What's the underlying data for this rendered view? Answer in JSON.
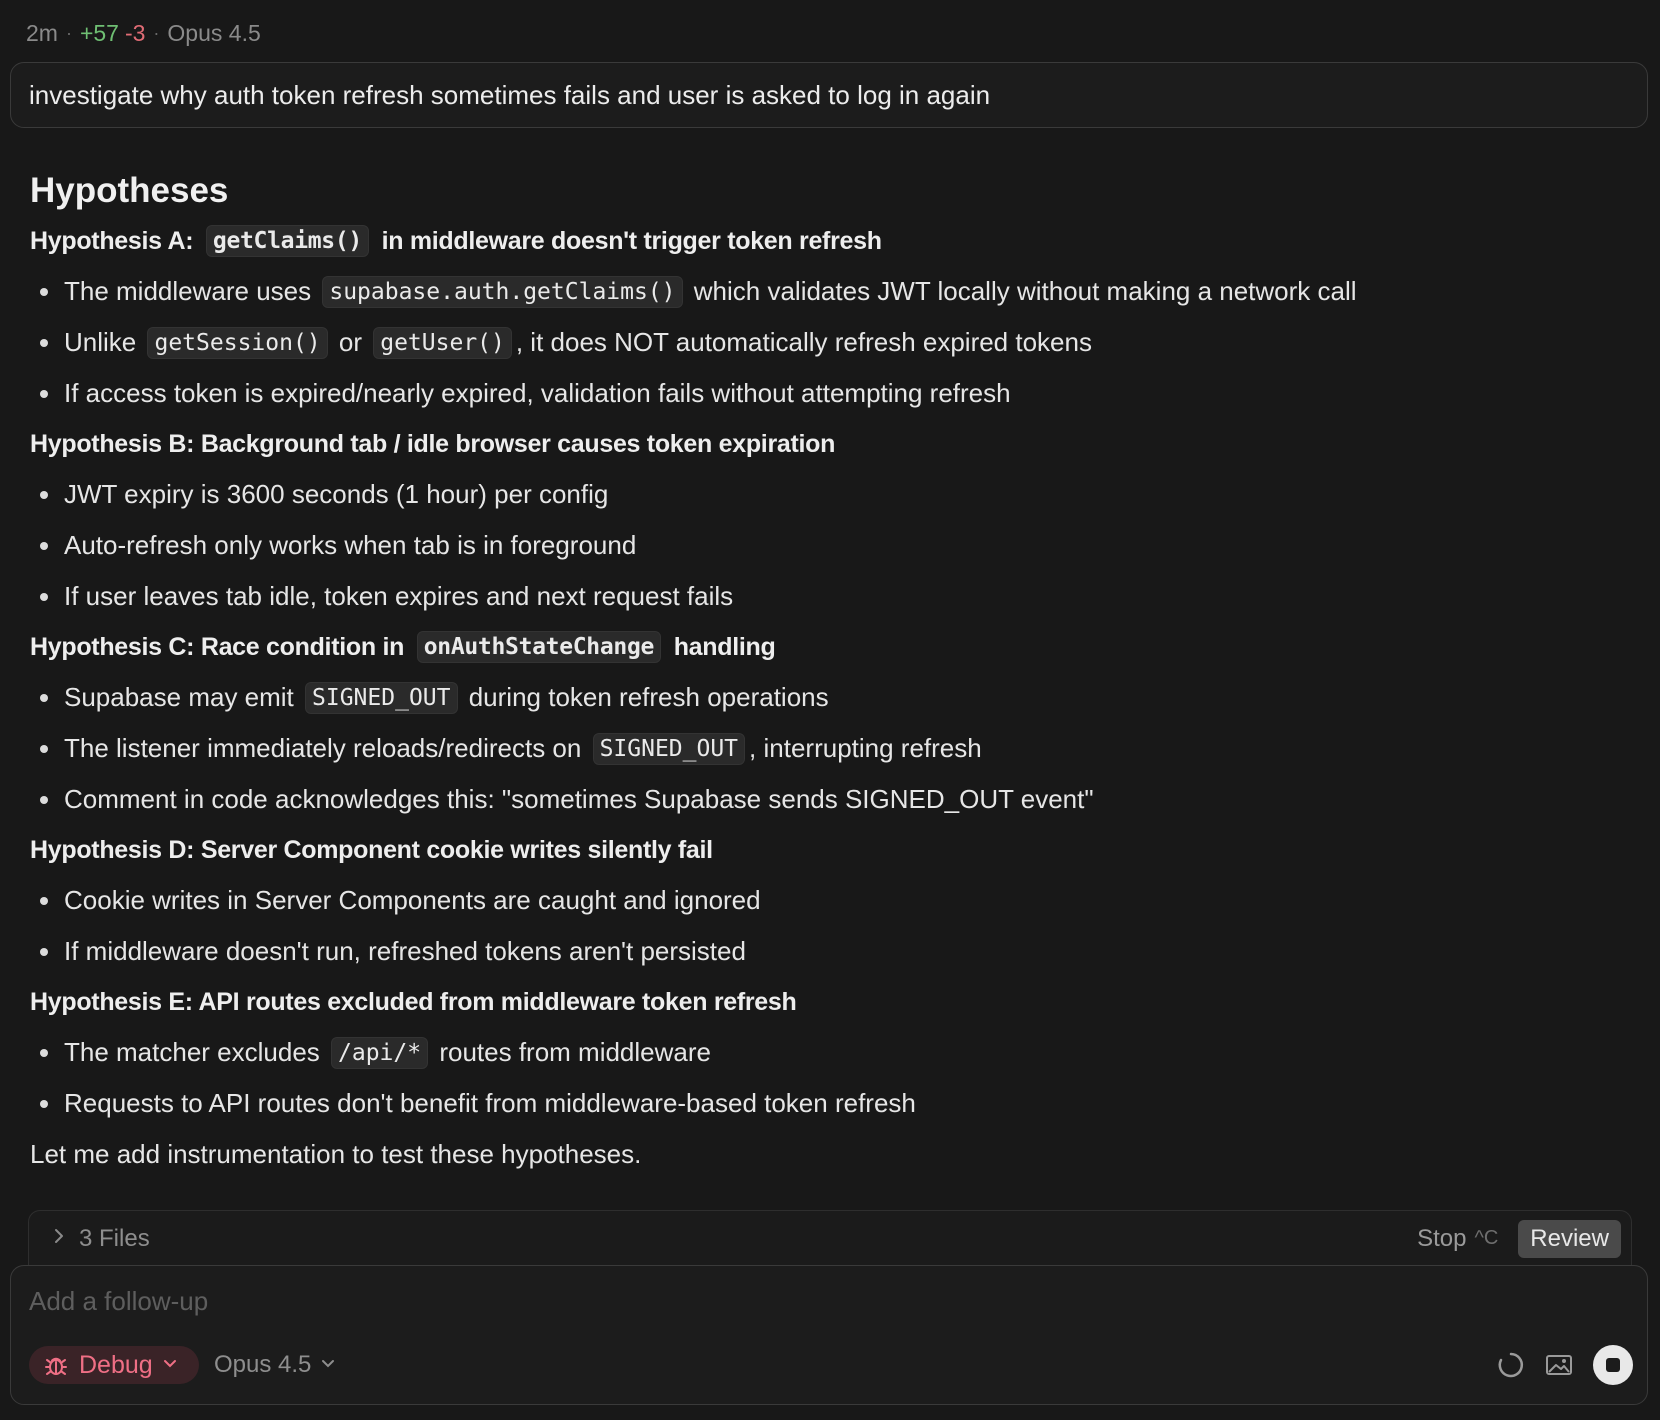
{
  "header": {
    "elapsed": "2m",
    "lines_added": "+57",
    "lines_removed": "-3",
    "model": "Opus 4.5"
  },
  "prompt": "investigate why auth token refresh sometimes fails and user is asked to log in again",
  "title": "Hypotheses",
  "hypotheses": [
    {
      "heading_pre": "Hypothesis A: ",
      "heading_code": "getClaims()",
      "heading_post": " in middleware doesn't trigger token refresh",
      "bullets": [
        [
          "The middleware uses ",
          {
            "code": "supabase.auth.getClaims()"
          },
          " which validates JWT locally without making a network call"
        ],
        [
          "Unlike ",
          {
            "code": "getSession()"
          },
          " or ",
          {
            "code": "getUser()"
          },
          ", it does NOT automatically refresh expired tokens"
        ],
        [
          "If access token is expired/nearly expired, validation fails without attempting refresh"
        ]
      ]
    },
    {
      "heading_pre": "Hypothesis B: Background tab / idle browser causes token expiration",
      "heading_code": "",
      "heading_post": "",
      "bullets": [
        [
          "JWT expiry is 3600 seconds (1 hour) per config"
        ],
        [
          "Auto-refresh only works when tab is in foreground"
        ],
        [
          "If user leaves tab idle, token expires and next request fails"
        ]
      ]
    },
    {
      "heading_pre": "Hypothesis C: Race condition in ",
      "heading_code": "onAuthStateChange",
      "heading_post": " handling",
      "bullets": [
        [
          "Supabase may emit ",
          {
            "code": "SIGNED_OUT"
          },
          " during token refresh operations"
        ],
        [
          "The listener immediately reloads/redirects on ",
          {
            "code": "SIGNED_OUT"
          },
          ", interrupting refresh"
        ],
        [
          "Comment in code acknowledges this: \"sometimes Supabase sends SIGNED_OUT event\""
        ]
      ]
    },
    {
      "heading_pre": "Hypothesis D: Server Component cookie writes silently fail",
      "heading_code": "",
      "heading_post": "",
      "bullets": [
        [
          "Cookie writes in Server Components are caught and ignored"
        ],
        [
          "If middleware doesn't run, refreshed tokens aren't persisted"
        ]
      ]
    },
    {
      "heading_pre": "Hypothesis E: API routes excluded from middleware token refresh",
      "heading_code": "",
      "heading_post": "",
      "bullets": [
        [
          "The matcher excludes ",
          {
            "code": "/api/*"
          },
          " routes from middleware"
        ],
        [
          "Requests to API routes don't benefit from middleware-based token refresh"
        ]
      ]
    }
  ],
  "closing": "Let me add instrumentation to test these hypotheses.",
  "files_bar": {
    "label": "3 Files",
    "stop_label": "Stop",
    "stop_shortcut": "^C",
    "review_label": "Review"
  },
  "composer": {
    "placeholder": "Add a follow-up",
    "mode_label": "Debug",
    "model_label": "Opus 4.5"
  },
  "colors": {
    "background": "#181818",
    "added": "#6fbf73",
    "removed": "#e06c75",
    "debug_accent": "#ef6f85"
  },
  "icons": {
    "files_toggle": "chevron-right-icon",
    "mode": "bug-icon",
    "dropdown": "chevron-down-icon",
    "status": "spinner-icon",
    "attach": "image-icon",
    "stop": "stop-icon"
  }
}
